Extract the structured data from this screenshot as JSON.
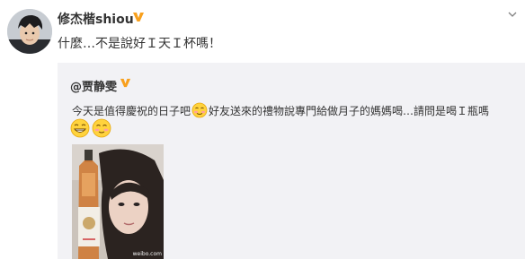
{
  "post": {
    "author": "修杰楷shiou",
    "text": "什麼…不是說好Ｉ天Ｉ杯嗎！",
    "avatar_icon": "user-avatar"
  },
  "repost": {
    "author": "@贾静雯",
    "text_before": "今天是值得慶祝的日子吧",
    "text_after": "好友送來的禮物說專門給做月子的媽媽喝…請問是喝Ｉ瓶嗎",
    "image_watermark": "weibo.com"
  },
  "icons": {
    "verified": "verified-v-badge",
    "menu": "chevron-down-icon",
    "inline_emoji": "shy-face-emoji",
    "emoji_row": [
      "grin-face-emoji",
      "shy-face-emoji"
    ]
  },
  "colors": {
    "verified_orange": "#f8a01d",
    "repost_bg": "#f2f2f5",
    "text": "#333333"
  }
}
